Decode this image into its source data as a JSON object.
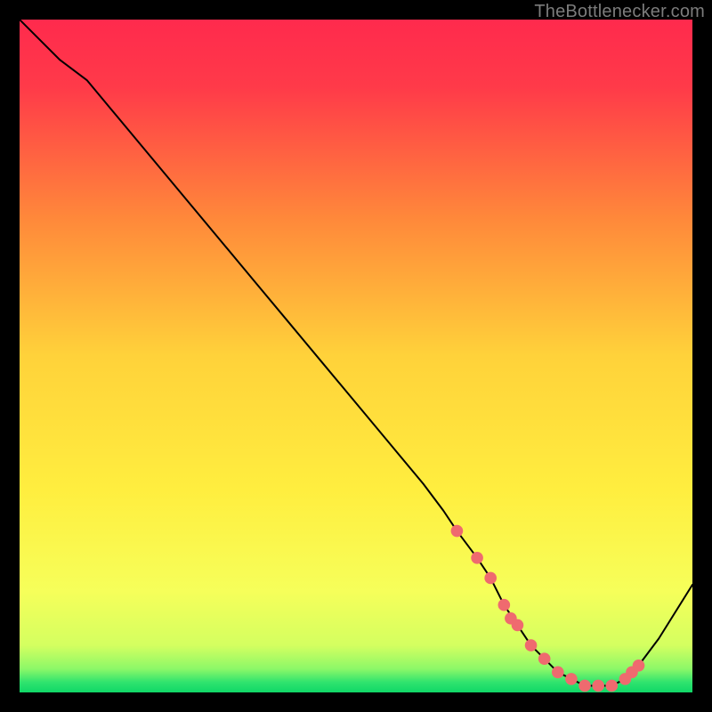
{
  "watermark": "TheBottlenecker.com",
  "colors": {
    "bg": "#000000",
    "grad_top": "#ff2a4d",
    "grad_mid": "#ffe23a",
    "grad_low": "#f2ff60",
    "grad_green": "#18e06a",
    "curve": "#000000",
    "marker": "#ef6a6f"
  },
  "chart_data": {
    "type": "line",
    "title": "",
    "xlabel": "",
    "ylabel": "",
    "xlim": [
      0,
      100
    ],
    "ylim": [
      0,
      100
    ],
    "grid": false,
    "curve": {
      "name": "bottleneck-curve",
      "x": [
        0,
        3,
        6,
        10,
        15,
        20,
        25,
        30,
        35,
        40,
        45,
        50,
        55,
        60,
        63,
        65,
        68,
        70,
        72,
        74,
        76,
        78,
        80,
        82,
        84,
        86,
        88,
        90,
        92,
        95,
        100
      ],
      "y": [
        100,
        97,
        94,
        91,
        85,
        79,
        73,
        67,
        61,
        55,
        49,
        43,
        37,
        31,
        27,
        24,
        20,
        17,
        13,
        10,
        7,
        5,
        3,
        2,
        1,
        1,
        1,
        2,
        4,
        8,
        16
      ]
    },
    "markers": {
      "name": "highlight-points",
      "x": [
        65,
        68,
        70,
        72,
        73,
        74,
        76,
        78,
        80,
        82,
        84,
        86,
        88,
        90,
        91,
        92
      ],
      "y": [
        24,
        20,
        17,
        13,
        11,
        10,
        7,
        5,
        3,
        2,
        1,
        1,
        1,
        2,
        3,
        4
      ]
    }
  }
}
